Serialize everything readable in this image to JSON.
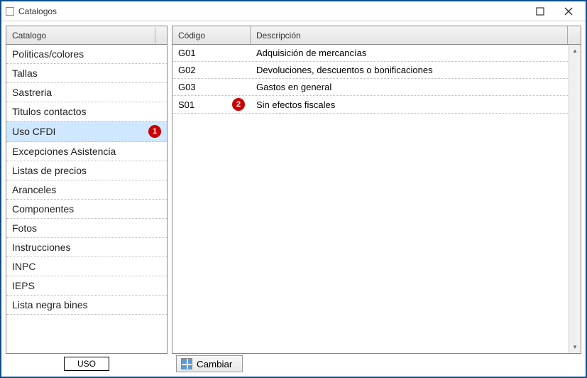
{
  "window": {
    "title": "Catalogos"
  },
  "left": {
    "header": "Catalogo",
    "items": [
      {
        "label": "Politicas/colores",
        "selected": false
      },
      {
        "label": "Tallas",
        "selected": false
      },
      {
        "label": "Sastreria",
        "selected": false
      },
      {
        "label": "Titulos contactos",
        "selected": false
      },
      {
        "label": "Uso CFDI",
        "selected": true,
        "badge": "1"
      },
      {
        "label": "Excepciones Asistencia",
        "selected": false
      },
      {
        "label": "Listas de precios",
        "selected": false
      },
      {
        "label": "Aranceles",
        "selected": false
      },
      {
        "label": "Componentes",
        "selected": false
      },
      {
        "label": "Fotos",
        "selected": false
      },
      {
        "label": "Instrucciones",
        "selected": false
      },
      {
        "label": "INPC",
        "selected": false
      },
      {
        "label": "IEPS",
        "selected": false
      },
      {
        "label": "Lista negra bines",
        "selected": false
      }
    ]
  },
  "grid": {
    "headers": {
      "code": "Código",
      "desc": "Descripción"
    },
    "rows": [
      {
        "code": "G01",
        "desc": "Adquisición de mercancías"
      },
      {
        "code": "G02",
        "desc": "Devoluciones, descuentos o bonificaciones"
      },
      {
        "code": "G03",
        "desc": "Gastos en general"
      },
      {
        "code": "S01",
        "desc": "Sin efectos fiscales",
        "badge": "2"
      }
    ]
  },
  "footer": {
    "uso_label": "USO",
    "cambiar_label": "Cambiar"
  }
}
